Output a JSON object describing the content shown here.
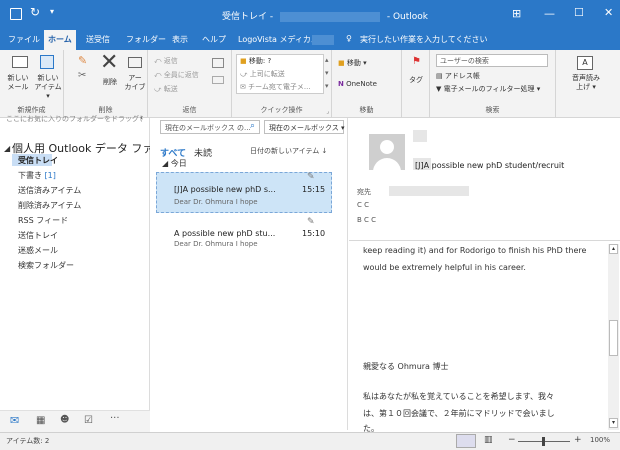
{
  "titlebar": {
    "title_folder": "受信トレイ - ",
    "title_app": "- Outlook",
    "controls": [
      "⊞",
      "—",
      "☐",
      "✕"
    ]
  },
  "menu": {
    "items": [
      "ファイル",
      "ホーム",
      "送受信",
      "フォルダー",
      "表示",
      "ヘルプ",
      "LogoVista メディカル"
    ],
    "active_index": 1,
    "tell_me": "実行したい作業を入力してください"
  },
  "ribbon": {
    "new_mail": "新しい\nメール",
    "new_item": "新しい\nアイテム ▾",
    "group_new": "新規作成",
    "delete": "削除",
    "archive": "アー\nカイブ",
    "group_delete": "削除",
    "reply": "返信",
    "reply_all": "全員に返信",
    "forward": "転送",
    "group_respond": "返信",
    "quick_steps": [
      "移動: ?",
      "上司に転送",
      "チーム宛て電子メ..."
    ],
    "group_quick": "クイック操作",
    "move": "移動 ▾",
    "onenote": "OneNote",
    "group_move": "移動",
    "tags": "タグ",
    "search_people_placeholder": "ユーザーの検索",
    "address_book": "アドレス帳",
    "filter_email": "電子メールのフィルター処理 ▾",
    "group_find": "検索",
    "read_aloud": "音声読み\n上げ ▾"
  },
  "sidebar": {
    "favorites_hint": "ここにお気に入りのフォルダーをドラッグし",
    "account": "個人用 Outlook データ ファ...",
    "folders": [
      {
        "label": "受信トレイ",
        "count": ""
      },
      {
        "label": "下書き",
        "count": "[1]"
      },
      {
        "label": "送信済みアイテム",
        "count": ""
      },
      {
        "label": "削除済みアイテム",
        "count": ""
      },
      {
        "label": "RSS フィード",
        "count": ""
      },
      {
        "label": "送信トレイ",
        "count": ""
      },
      {
        "label": "迷惑メール",
        "count": ""
      },
      {
        "label": "検索フォルダー",
        "count": ""
      }
    ]
  },
  "maillist": {
    "search_placeholder": "現在のメールボックス の...",
    "scope": "現在のメールボックス ▾",
    "tab_all": "すべて",
    "tab_unread": "未読",
    "sort": "日付の新しいアイテム ↓",
    "group_today": "◢ 今日",
    "items": [
      {
        "subject": "[J]A possible new phD s...",
        "time": "15:15",
        "preview": "Dear Dr. Ohmura  I hope",
        "selected": true
      },
      {
        "subject": "A possible new phD stu...",
        "time": "15:10",
        "preview": "Dear Dr. Ohmura  I hope",
        "selected": false
      }
    ]
  },
  "reading": {
    "subject": "[J]A possible new phD student/recruit",
    "to_label": "宛先",
    "cc_label": "C C",
    "bcc_label": "B C C",
    "body_lines": [
      "keep reading it) and for Rodorigo to finish his PhD there",
      "would be extremely helpful in his career.",
      "親愛なる Ohmura 博士",
      "私はあなたが私を覚えていることを希望します、我々",
      "は、第１０回会議で、２年前にマドリッドで会いまし",
      "た。"
    ]
  },
  "status": {
    "item_count": "アイテム数: 2",
    "zoom": "100%"
  },
  "colors": {
    "accent": "#2b78c8",
    "selected_row": "#cde4f7"
  }
}
